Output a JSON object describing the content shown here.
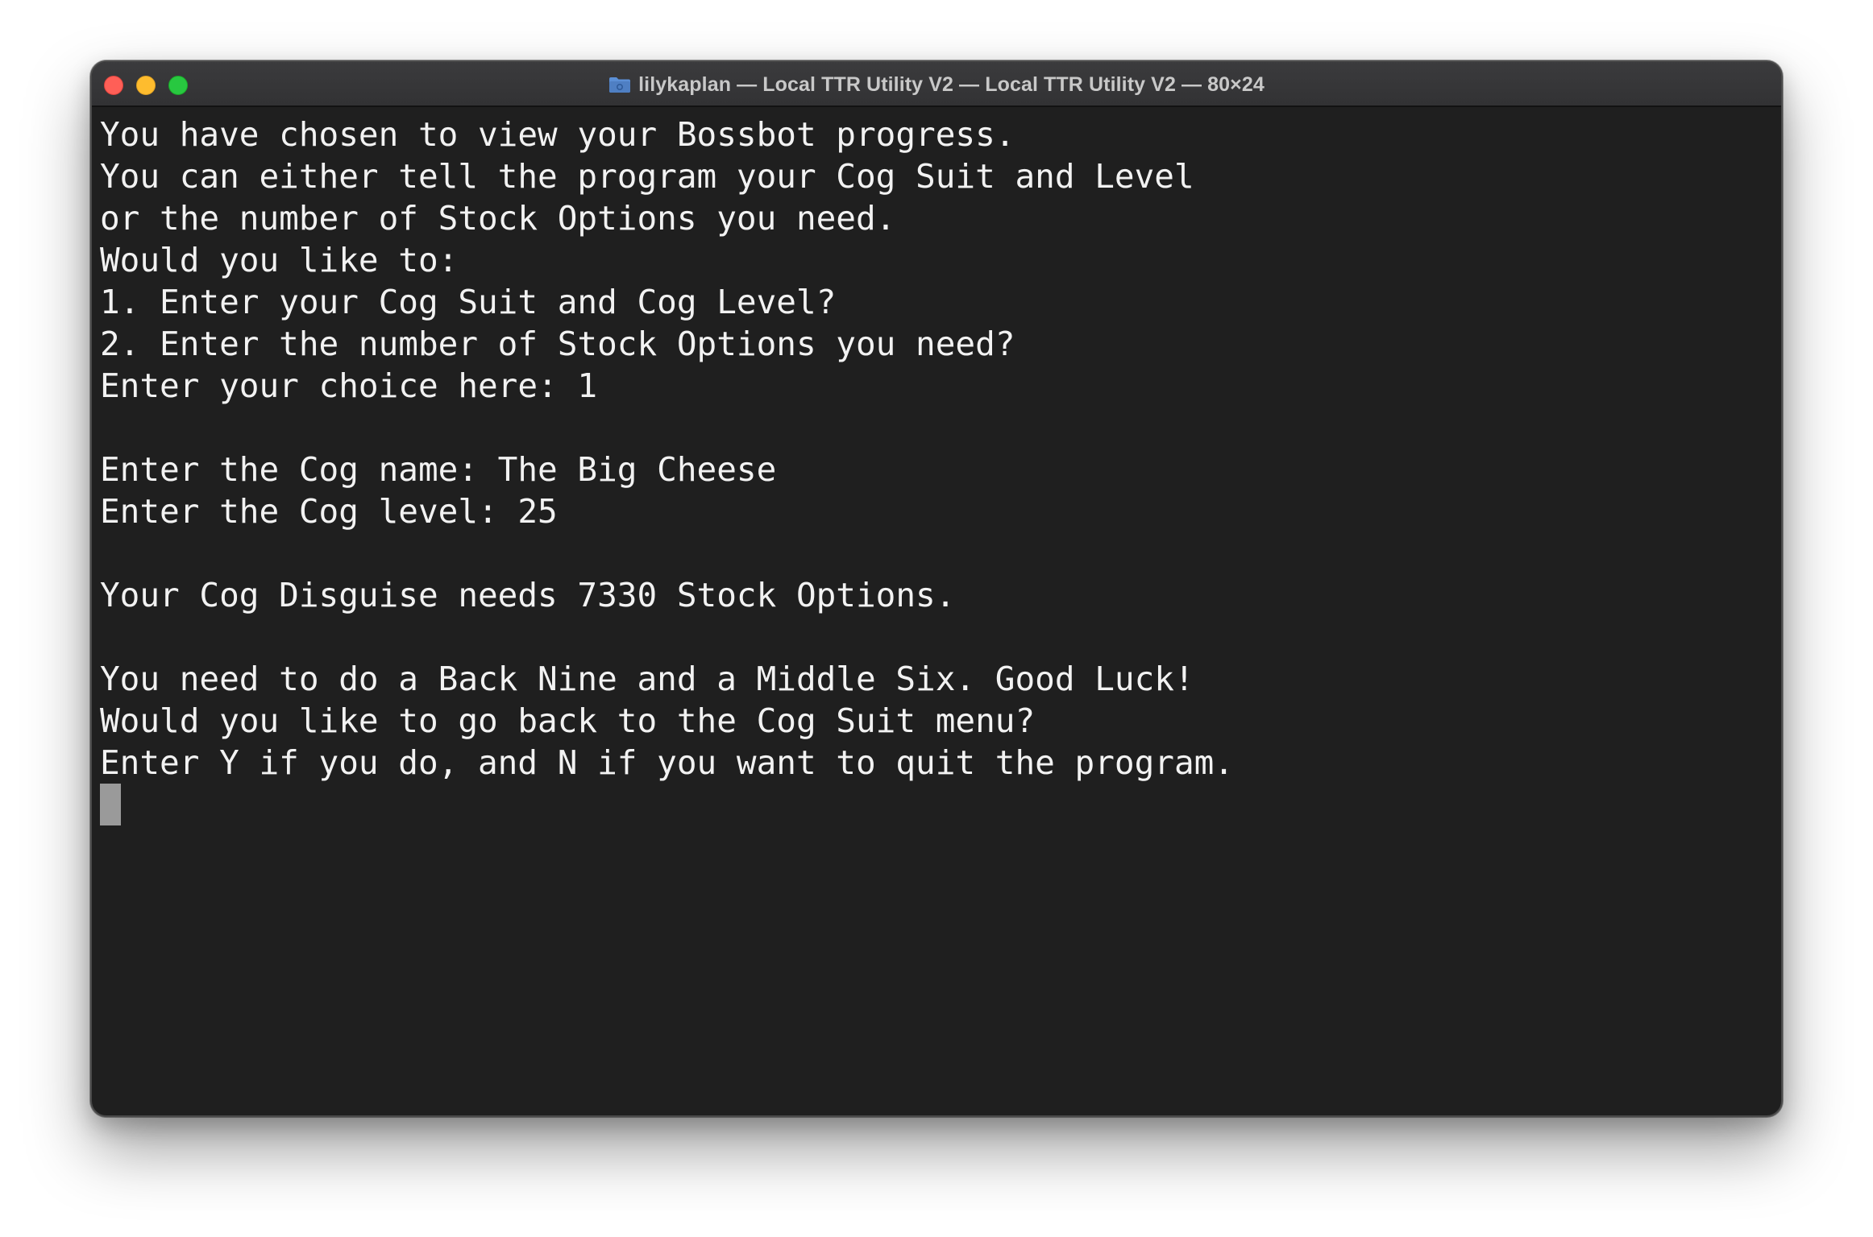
{
  "window": {
    "title": "lilykaplan — Local TTR Utility V2 — Local TTR Utility V2 — 80×24",
    "title_icon": "folder-icon",
    "traffic_lights": {
      "close_color": "#ff5f57",
      "minimize_color": "#febc2e",
      "zoom_color": "#28c840"
    }
  },
  "terminal": {
    "background": "#1f1f1f",
    "foreground": "#f2f2f2",
    "lines": [
      "You have chosen to view your Bossbot progress.",
      "You can either tell the program your Cog Suit and Level",
      "or the number of Stock Options you need.",
      "Would you like to:",
      "1. Enter your Cog Suit and Cog Level?",
      "2. Enter the number of Stock Options you need?",
      "Enter your choice here: 1",
      "",
      "Enter the Cog name: The Big Cheese",
      "Enter the Cog level: 25",
      "",
      "Your Cog Disguise needs 7330 Stock Options.",
      "",
      "You need to do a Back Nine and a Middle Six. Good Luck!",
      "Would you like to go back to the Cog Suit menu?",
      "Enter Y if you do, and N if you want to quit the program."
    ],
    "input": ""
  }
}
